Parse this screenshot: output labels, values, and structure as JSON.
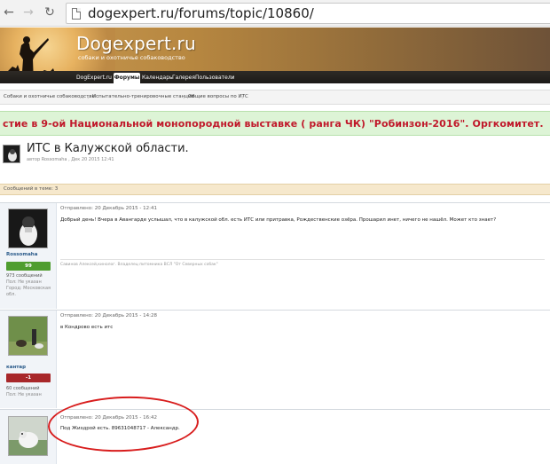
{
  "browser": {
    "url": "dogexpert.ru/forums/topic/10860/"
  },
  "site": {
    "title": "Dogexpert.ru",
    "subtitle": "собаки и охотничье собаководство",
    "nav": [
      "DogExpert.ru",
      "Форумы",
      "Календарь",
      "Галерея",
      "Пользователи"
    ],
    "nav_active": 1
  },
  "breadcrumb": [
    "Собаки и охотничье собаководство",
    "Испытательно-тренировочные станции",
    "Общие вопросы по ИТС"
  ],
  "notice": "стие в 9-ой Национальной монопородной выставке ( ранга ЧК) \"Робинзон-2016\". Оргкомитет.",
  "topic": {
    "title": "ИТС в Калужской области.",
    "meta": "автор Rossomaha , Дек 20 2015 12:41",
    "count": "Сообщений в теме: 3"
  },
  "posts": [
    {
      "user": "Rossomaha",
      "rep": "99",
      "stats": [
        "973 сообщений",
        "Пол: Не указан",
        "Город: Московская обл."
      ],
      "date": "Отправлено: 20 Декабрь 2015 - 12:41",
      "body": "Добрый день! Вчера в Авангарде услышал, что в калужской обл. есть ИТС или притравка, Рождественские озёра. Прошарил инет, ничего не нашёл. Может кто знает?",
      "signature": "Савинов Алексей,кинолог. Владелец питомника ВСЛ \"От Северных собак\""
    },
    {
      "user": "кантар",
      "rep": "-1",
      "stats": [
        "60 сообщений",
        "Пол: Не указан"
      ],
      "date": "Отправлено: 20 Декабрь 2015 - 14:28",
      "body": "в Кондрово есть итс"
    },
    {
      "date": "Отправлено: 20 Декабрь 2015 - 16:42",
      "body": "Под Жиздрой есть. 89631048717 - Александр."
    }
  ]
}
